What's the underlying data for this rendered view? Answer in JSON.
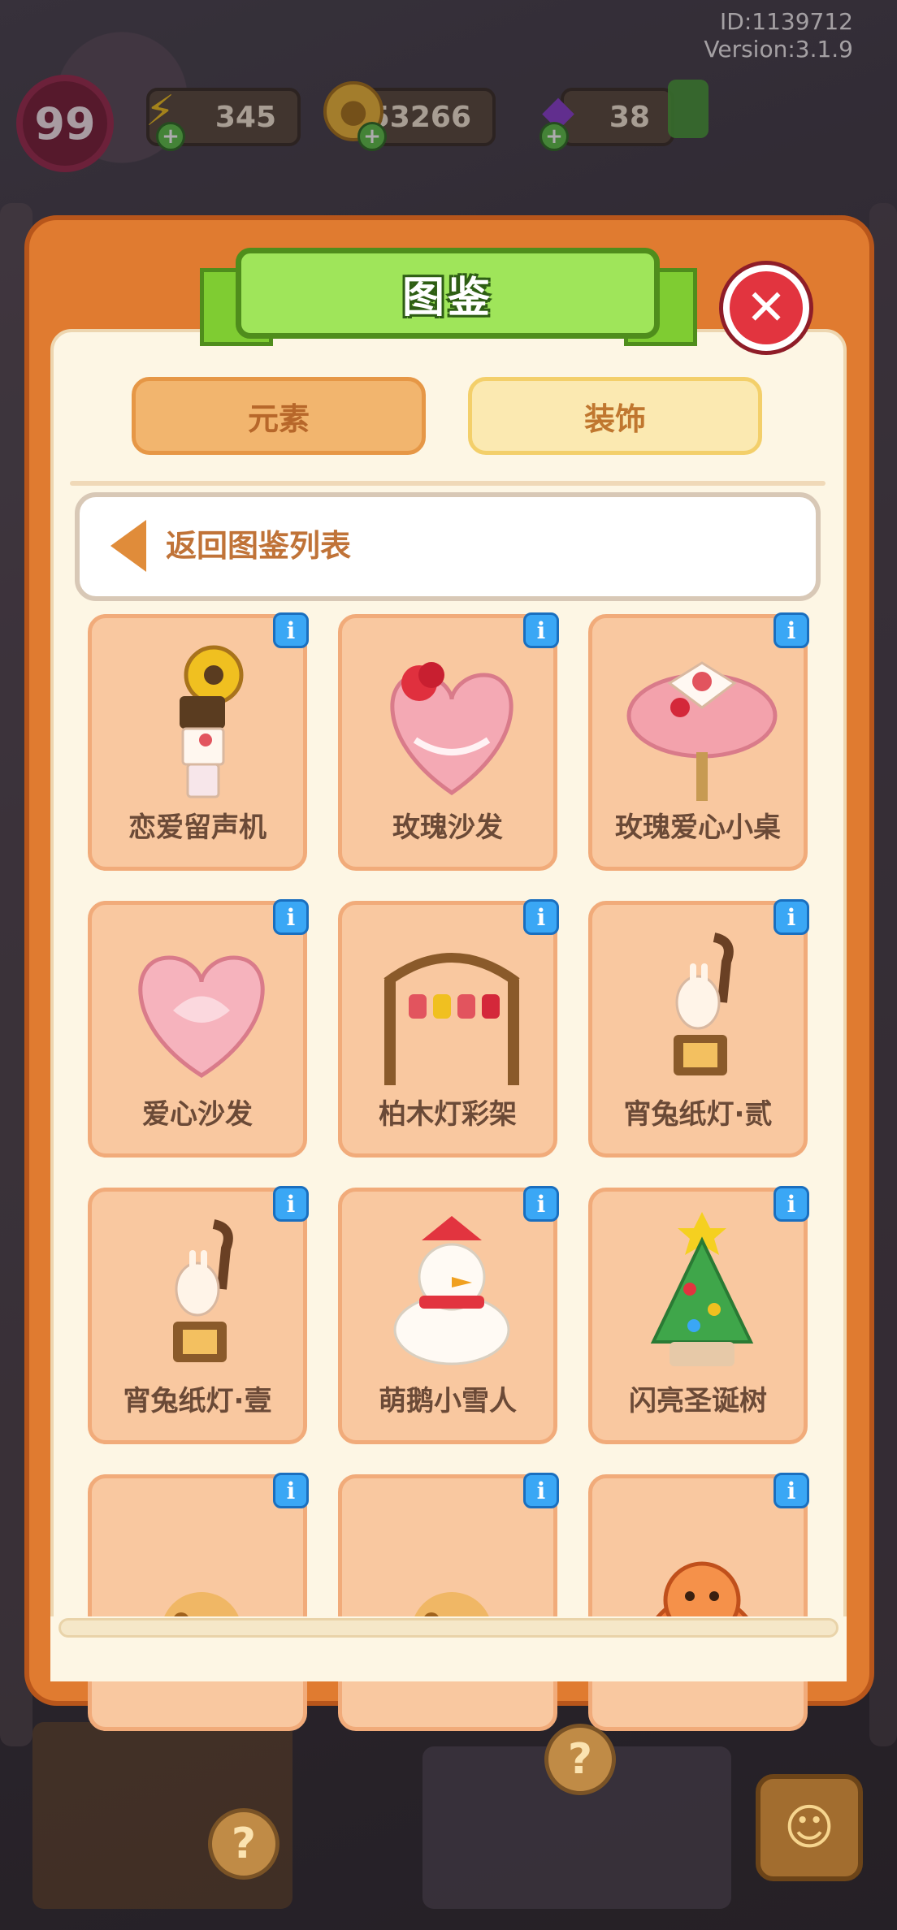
{
  "header": {
    "id_text": "ID:1139712",
    "version_text": "Version:3.1.9",
    "level": "99",
    "energy": "345",
    "coins": "53266",
    "gems": "38"
  },
  "dialog": {
    "title": "图鉴",
    "close_symbol": "✕",
    "tabs": [
      {
        "label": "元素",
        "active": false
      },
      {
        "label": "装饰",
        "active": true
      }
    ],
    "back_label": "返回图鉴列表",
    "items": [
      {
        "label": "恋爱留声机",
        "icon": "gramophone-icon"
      },
      {
        "label": "玫瑰沙发",
        "icon": "rose-heart-sofa-icon"
      },
      {
        "label": "玫瑰爱心小桌",
        "icon": "rose-heart-table-icon"
      },
      {
        "label": "爱心沙发",
        "icon": "heart-sofa-icon"
      },
      {
        "label": "柏木灯彩架",
        "icon": "lantern-rack-icon"
      },
      {
        "label": "宵兔纸灯·贰",
        "icon": "rabbit-lantern-icon"
      },
      {
        "label": "宵兔纸灯·壹",
        "icon": "rabbit-lantern-icon"
      },
      {
        "label": "萌鹅小雪人",
        "icon": "snowman-icon"
      },
      {
        "label": "闪亮圣诞树",
        "icon": "christmas-tree-icon"
      },
      {
        "label": "",
        "icon": "cat-bed-icon"
      },
      {
        "label": "",
        "icon": "cat-bed-icon"
      },
      {
        "label": "",
        "icon": "dragon-icon"
      }
    ],
    "info_symbol": "i"
  },
  "colors": {
    "panel_orange": "#e07b30",
    "ribbon_green": "#9fe55a",
    "card_peach": "#f9c8a0",
    "info_blue": "#3aa7f5",
    "close_red": "#e2343f"
  }
}
